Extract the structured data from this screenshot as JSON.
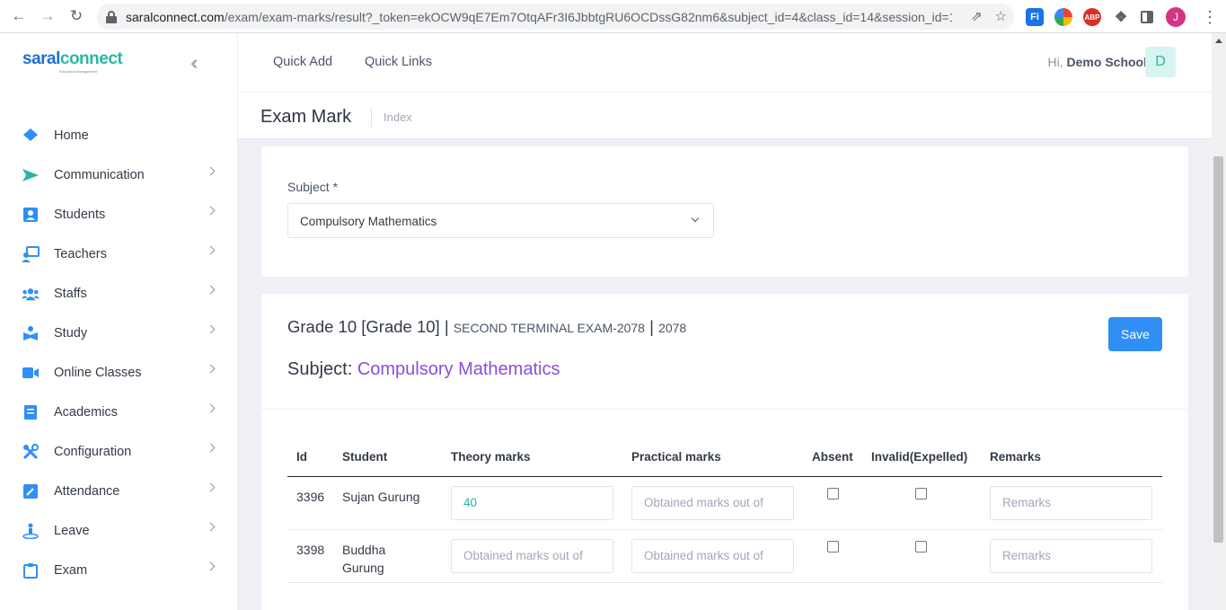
{
  "browser": {
    "url_host": "saralconnect.com",
    "url_path": "/exam/exam-marks/result?_token=ekOCW9qE7Em7OtqAFr3I6JbbtgRU6OCDssG82nm6&subject_id=4&class_id=14&session_id=1...",
    "profile_initial": "J",
    "ext_fi": "Fi",
    "ext_abp": "ABP"
  },
  "logo": {
    "part1": "saral",
    "part2": "connect",
    "tagline": "Education Management"
  },
  "sidebar": {
    "items": [
      {
        "label": "Home",
        "icon": "home-icon"
      },
      {
        "label": "Communication",
        "icon": "send-icon"
      },
      {
        "label": "Students",
        "icon": "student-icon"
      },
      {
        "label": "Teachers",
        "icon": "teacher-icon"
      },
      {
        "label": "Staffs",
        "icon": "staff-icon"
      },
      {
        "label": "Study",
        "icon": "study-icon"
      },
      {
        "label": "Online Classes",
        "icon": "video-icon"
      },
      {
        "label": "Academics",
        "icon": "book-icon"
      },
      {
        "label": "Configuration",
        "icon": "tools-icon"
      },
      {
        "label": "Attendance",
        "icon": "edit-icon"
      },
      {
        "label": "Leave",
        "icon": "leave-icon"
      },
      {
        "label": "Exam",
        "icon": "clipboard-icon"
      }
    ]
  },
  "topbar": {
    "quick_add": "Quick Add",
    "quick_links": "Quick Links",
    "greeting_prefix": "Hi,",
    "user_name": "Demo School",
    "user_initial": "D"
  },
  "page": {
    "title": "Exam Mark",
    "breadcrumb": "Index"
  },
  "filter": {
    "subject_label": "Subject *",
    "subject_value": "Compulsory Mathematics"
  },
  "result": {
    "grade": "Grade 10 [Grade 10]",
    "sep": "|",
    "exam": "SECOND TERMINAL EXAM-2078",
    "year": "2078",
    "subject_prefix": "Subject:",
    "subject_name": "Compulsory Mathematics",
    "save_label": "Save"
  },
  "table": {
    "headers": [
      "Id",
      "Student",
      "Theory marks",
      "Practical marks",
      "Absent",
      "Invalid(Expelled)",
      "Remarks"
    ],
    "rows": [
      {
        "id": "3396",
        "student": "Sujan Gurung",
        "theory": "40",
        "theory_placeholder": "Obtained marks out of",
        "practical_placeholder": "Obtained marks out of",
        "remarks_placeholder": "Remarks"
      },
      {
        "id": "3398",
        "student": "Buddha Gurung",
        "theory": "",
        "theory_placeholder": "Obtained marks out of",
        "practical_placeholder": "Obtained marks out of",
        "remarks_placeholder": "Remarks"
      }
    ]
  },
  "colors": {
    "accent": "#2f8ff5",
    "subject": "#8a4de0",
    "brand_teal": "#2db6a3"
  }
}
